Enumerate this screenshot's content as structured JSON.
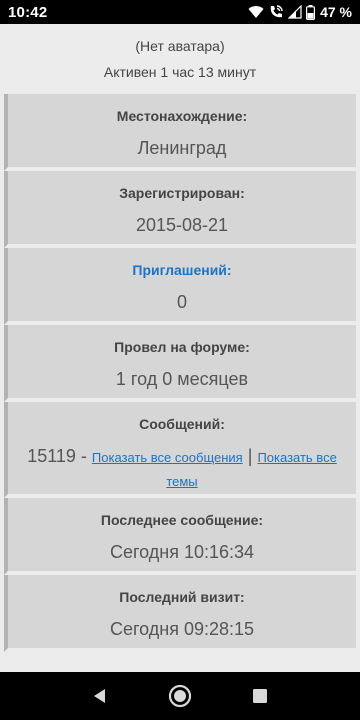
{
  "status_bar": {
    "time": "10:42",
    "battery_percent": "47 %"
  },
  "profile": {
    "avatar_text": "(Нет аватара)",
    "activity": "Активен 1 час 13 минут"
  },
  "fields": {
    "location": {
      "label": "Местонахождение:",
      "value": "Ленинград"
    },
    "registered": {
      "label": "Зарегистрирован:",
      "value": "2015-08-21"
    },
    "invites": {
      "label": "Приглашений:",
      "value": "0"
    },
    "time_on_forum": {
      "label": "Провел на форуме:",
      "value": "1 год 0 месяцев"
    },
    "messages": {
      "label": "Сообщений:",
      "count": "15119 -",
      "show_all_link": "Показать все сообщения",
      "separator": "|",
      "show_topics_link_part1": "Показать все",
      "show_topics_link_part2": "темы"
    },
    "last_message": {
      "label": "Последнее сообщение:",
      "value": "Сегодня 10:16:34"
    },
    "last_visit": {
      "label": "Последний визит:",
      "value": "Сегодня 09:28:15"
    }
  },
  "colors": {
    "link": "#1a73c8",
    "row_bg": "#d6d6d6",
    "page_bg": "#ececec"
  }
}
